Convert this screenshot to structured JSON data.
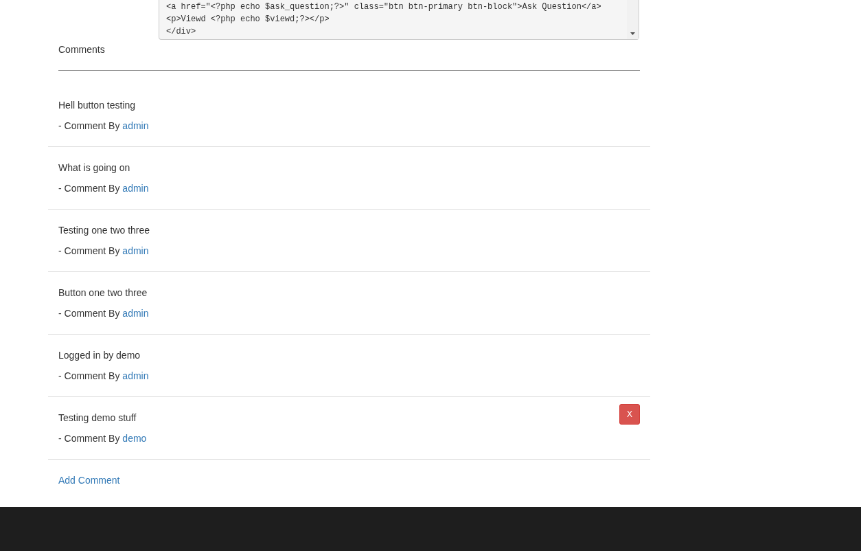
{
  "code_box": {
    "lines": [
      "<a href=\"<?php echo $ask_question;?>\" class=\"btn btn-primary btn-block\">Ask Question</a>",
      "<p>Viewd <?php echo $viewd;?></p>",
      "</div>"
    ]
  },
  "comments_section": {
    "title": "Comments",
    "comments": [
      {
        "text": "Hell button testing",
        "by_label": "- Comment By",
        "author": "admin"
      },
      {
        "text": "What is going on",
        "by_label": "- Comment By",
        "author": "admin"
      },
      {
        "text": "Testing one two three",
        "by_label": "- Comment By",
        "author": "admin"
      },
      {
        "text": "Button one two three",
        "by_label": "- Comment By",
        "author": "admin"
      },
      {
        "text": "Logged in by demo",
        "by_label": "- Comment By",
        "author": "admin"
      },
      {
        "text": "Testing demo stuff",
        "by_label": "- Comment By",
        "author": "demo",
        "delete_button": "X"
      }
    ],
    "add_comment": "Add Comment"
  }
}
